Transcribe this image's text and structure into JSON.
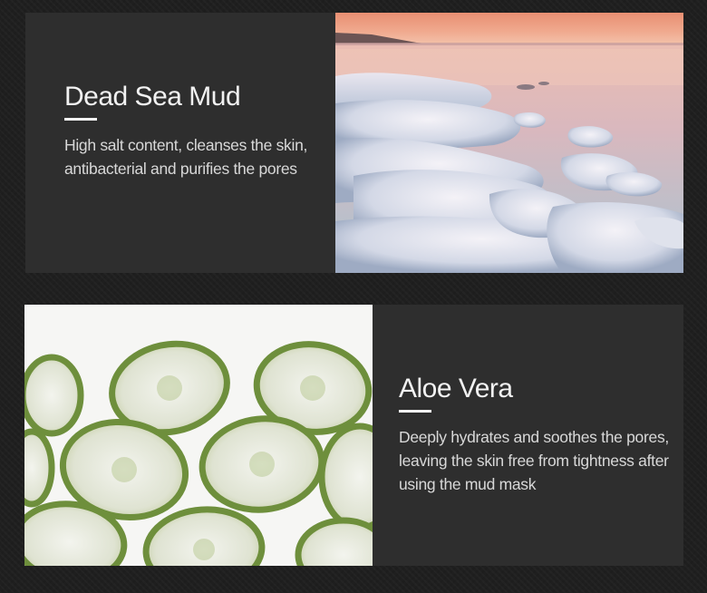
{
  "sections": [
    {
      "title": "Dead Sea Mud",
      "description": "High salt content, cleanses the skin, antibacterial and purifies the pores",
      "image": "dead-sea-salt-shore-photo"
    },
    {
      "title": "Aloe Vera",
      "description": "Deeply hydrates and soothes the pores, leaving the skin free from tightness after using the mud mask",
      "image": "aloe-vera-slices-photo"
    }
  ],
  "colors": {
    "background": "#1f1f1f",
    "card": "#2e2e2e",
    "text": "#e9e9e9",
    "aloe_green": "#7a9a45"
  }
}
